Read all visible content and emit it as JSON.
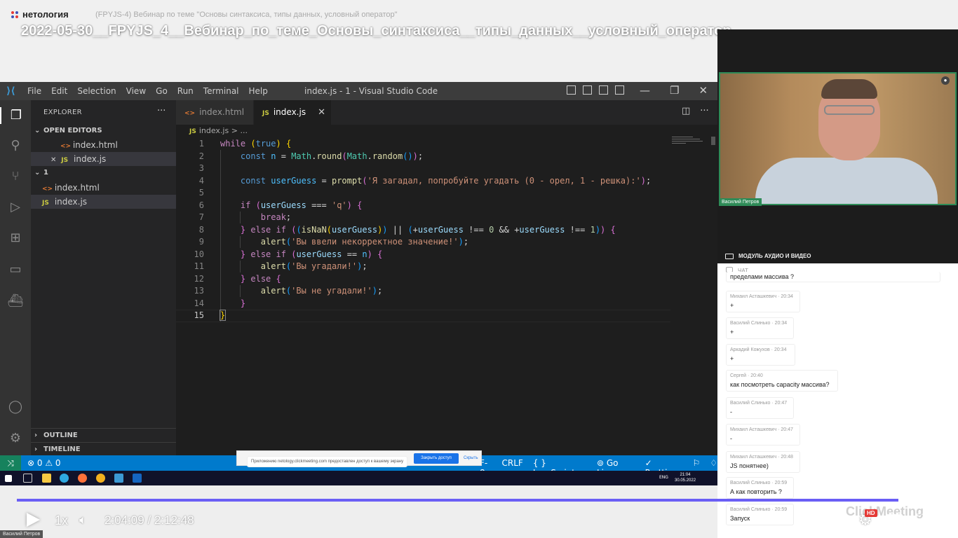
{
  "header": {
    "logo": "нетология",
    "session_subtitle": "(FPYJS-4) Вебинар по теме \"Основы синтаксиса, типы данных, условный оператор\"",
    "video_title": "2022-05-30__FPYJS_4__Вебинар_по_теме_Основы_синтаксиса__типы_данных__условный_оператор"
  },
  "vscode": {
    "menu": [
      "File",
      "Edit",
      "Selection",
      "View",
      "Go",
      "Run",
      "Terminal",
      "Help"
    ],
    "window_title": "index.js - 1 - Visual Studio Code",
    "explorer_title": "EXPLORER",
    "open_editors_label": "OPEN EDITORS",
    "open_editors": [
      {
        "name": "index.html",
        "icon": "<>"
      },
      {
        "name": "index.js",
        "icon": "JS"
      }
    ],
    "folder_label": "1",
    "folder_files": [
      {
        "name": "index.html",
        "icon": "<>"
      },
      {
        "name": "index.js",
        "icon": "JS"
      }
    ],
    "outline_label": "OUTLINE",
    "timeline_label": "TIMELINE",
    "tabs": [
      {
        "name": "index.html",
        "icon": "<>"
      },
      {
        "name": "index.js",
        "icon": "JS"
      }
    ],
    "breadcrumb_file": "index.js",
    "breadcrumb_icon": "JS",
    "breadcrumb_rest": "> ...",
    "line_numbers": [
      "1",
      "2",
      "3",
      "4",
      "5",
      "6",
      "7",
      "8",
      "9",
      "10",
      "11",
      "12",
      "13",
      "14",
      "15"
    ],
    "code_strings": {
      "prompt_msg": "'Я загадал, попробуйте угадать (0 - орел, 1 - решка):'",
      "q": "'q'",
      "invalid": "'Вы ввели некорректное значение!'",
      "win": "'Вы угадали!'",
      "lose": "'Вы не угадали!'"
    },
    "status": {
      "problems": "⊗ 0 ⚠ 0",
      "eol": "F-8",
      "crlf": "CRLF",
      "language": "{ } JavaScript",
      "golive": "Go Live",
      "prettier": "✓ Prettier"
    },
    "share_banner": {
      "message": "Приложению netology.clickmeeting.com предоставлен доступ к вашему экрану",
      "stop": "Закрыть доступ",
      "hide": "Скрыть"
    },
    "clock_time": "21:04",
    "clock_date": "30.05.2022",
    "lang": "ENG"
  },
  "webcam": {
    "presenter_name": "Василий Петров"
  },
  "av_module_label": "МОДУЛЬ АУДИО И ВИДЕО",
  "chat": {
    "label": "ЧАТ",
    "messages": [
      {
        "author": "",
        "time": "",
        "text": "пределами массива ?"
      },
      {
        "author": "Михаил Асташкевич",
        "time": "20:34",
        "text": "+"
      },
      {
        "author": "Василий Слинько",
        "time": "20:34",
        "text": "+"
      },
      {
        "author": "Аркадий Кожухов",
        "time": "20:34",
        "text": "+"
      },
      {
        "author": "Сергей",
        "time": "20:40",
        "text": "как посмотреть capacity массива?"
      },
      {
        "author": "Василий Слинько",
        "time": "20:47",
        "text": "-"
      },
      {
        "author": "Михаил Асташкевич",
        "time": "20:47",
        "text": "-"
      },
      {
        "author": "Михаил Асташкевич",
        "time": "20:48",
        "text": "JS понятнее)"
      },
      {
        "author": "Василий Слинько",
        "time": "20:59",
        "text": "А как повторить ?"
      },
      {
        "author": "Василий Слинько",
        "time": "20:59",
        "text": "Запуск"
      }
    ]
  },
  "player": {
    "speed": "1x",
    "current_time": "2:04:09",
    "duration": "2:12:48",
    "time_display": "2:04:09 / 2:12:48",
    "progress": 0.9534,
    "hd_badge": "HD",
    "watermark": "ClickMeeting",
    "presenter_tag": "Василий Петров",
    "accent_color": "#6a5ef5"
  }
}
